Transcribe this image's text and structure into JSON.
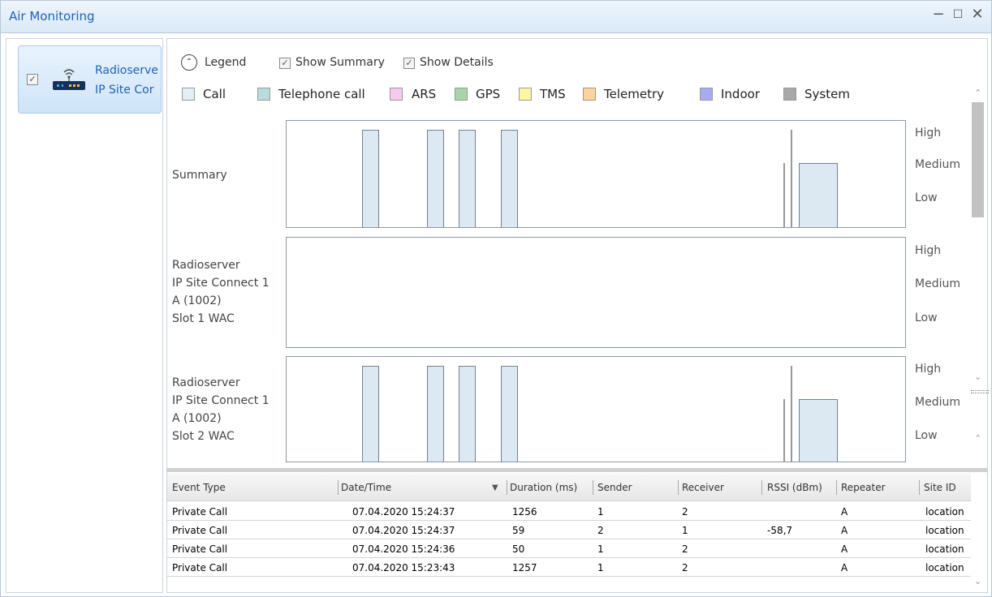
{
  "window": {
    "title": "Air Monitoring",
    "controls": {
      "minimize": "−",
      "maximize": "☐",
      "close": "✕"
    }
  },
  "device": {
    "checked": true,
    "check_mark": "✓",
    "name_line1": "Radioserve",
    "name_line2": "IP Site Cor",
    "icon": "radio-router-icon"
  },
  "toolbar": {
    "legend_label": "Legend",
    "legend_arrow": "⌃",
    "show_summary": {
      "label": "Show Summary",
      "checked": true
    },
    "show_details": {
      "label": "Show Details",
      "checked": true
    },
    "check_mark": "✓"
  },
  "legend": [
    {
      "label": "Call",
      "color": "#e4eef6"
    },
    {
      "label": "Telephone call",
      "color": "#b9dcdc"
    },
    {
      "label": "ARS",
      "color": "#f5c9f0"
    },
    {
      "label": "GPS",
      "color": "#a8d5a8"
    },
    {
      "label": "TMS",
      "color": "#fdf6a4"
    },
    {
      "label": "Telemetry",
      "color": "#fbd39b"
    },
    {
      "label": "Indoor",
      "color": "#a9abf2"
    },
    {
      "label": "System",
      "color": "#a8a8a8"
    }
  ],
  "charts": [
    {
      "label_lines": [
        "Summary"
      ],
      "levels": [
        "High",
        "Medium",
        "Low"
      ]
    },
    {
      "label_lines": [
        "Radioserver",
        "IP Site Connect 1",
        "A (1002)",
        "Slot 1 WAC"
      ],
      "levels": [
        "High",
        "Medium",
        "Low"
      ]
    },
    {
      "label_lines": [
        "Radioserver",
        "IP Site Connect 1",
        "A (1002)",
        "Slot 2 WAC"
      ],
      "levels": [
        "High",
        "Medium",
        "Low"
      ]
    }
  ],
  "table": {
    "columns": [
      "Event Type",
      "Date/Time",
      "Duration (ms)",
      "Sender",
      "Receiver",
      "RSSI (dBm)",
      "Repeater",
      "Site ID"
    ],
    "sort_indicator": "▼",
    "rows": [
      [
        "Private Call",
        "07.04.2020 15:24:37",
        "1256",
        "1",
        "2",
        "",
        "A",
        "location"
      ],
      [
        "Private Call",
        "07.04.2020 15:24:37",
        "59",
        "2",
        "1",
        "-58,7",
        "A",
        "location"
      ],
      [
        "Private Call",
        "07.04.2020 15:24:36",
        "50",
        "1",
        "2",
        "",
        "A",
        "location"
      ],
      [
        "Private Call",
        "07.04.2020 15:23:43",
        "1257",
        "1",
        "2",
        "",
        "A",
        "location"
      ]
    ]
  },
  "scroll": {
    "up": "⌃",
    "down": "⌄"
  }
}
